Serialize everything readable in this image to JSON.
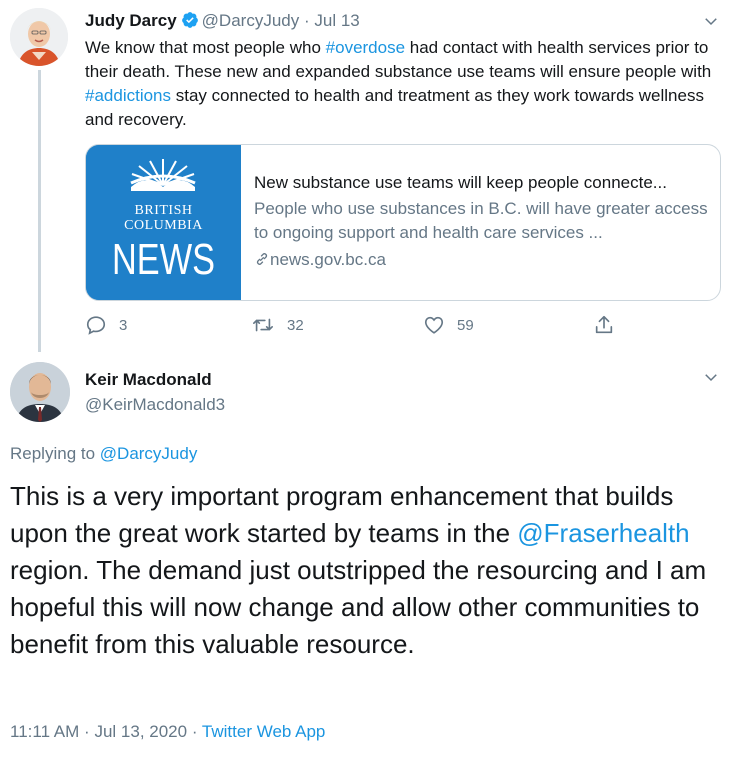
{
  "colors": {
    "link": "#1b95e0",
    "muted": "#657786",
    "border": "#ccd6dd",
    "verified": "#1da1f2",
    "card_image_bg": "#1f80c9"
  },
  "tweet1": {
    "author_name": "Judy Darcy",
    "verified_icon": "verified-badge-icon",
    "handle": "@DarcyJudy",
    "separator": "·",
    "date": "Jul 13",
    "text_parts": {
      "p1": "We know that most people who ",
      "hashtag1": "#overdose",
      "p2": " had contact with health services prior to their death. These new and expanded substance use teams will ensure people with ",
      "hashtag2": "#addictions",
      "p3": " stay connected to health and treatment as they work towards wellness and recovery."
    },
    "card": {
      "image_line1": "BRITISH",
      "image_line2": "COLUMBIA",
      "image_line3": "NEWS",
      "title": "New substance use teams will keep people connecte...",
      "description": "People who use substances in B.C. will have greater access to ongoing support and health care services ...",
      "link_icon": "link-icon",
      "domain": "news.gov.bc.ca"
    },
    "actions": {
      "reply_count": "3",
      "retweet_count": "32",
      "like_count": "59"
    }
  },
  "tweet2": {
    "author_name": "Keir Macdonald",
    "handle": "@KeirMacdonald3",
    "replying_label": "Replying to ",
    "replying_handle": "@DarcyJudy",
    "text_parts": {
      "p1": "This is a very important program enhancement that builds upon the great work started by teams in the ",
      "mention": "@Fraserhealth",
      "p2": " region. The demand just outstripped the resourcing and I am hopeful this will now change and allow other communities to benefit from this valuable resource."
    },
    "time": "11:11 AM",
    "dot": "·",
    "date": "Jul 13, 2020",
    "source": "Twitter Web App"
  }
}
